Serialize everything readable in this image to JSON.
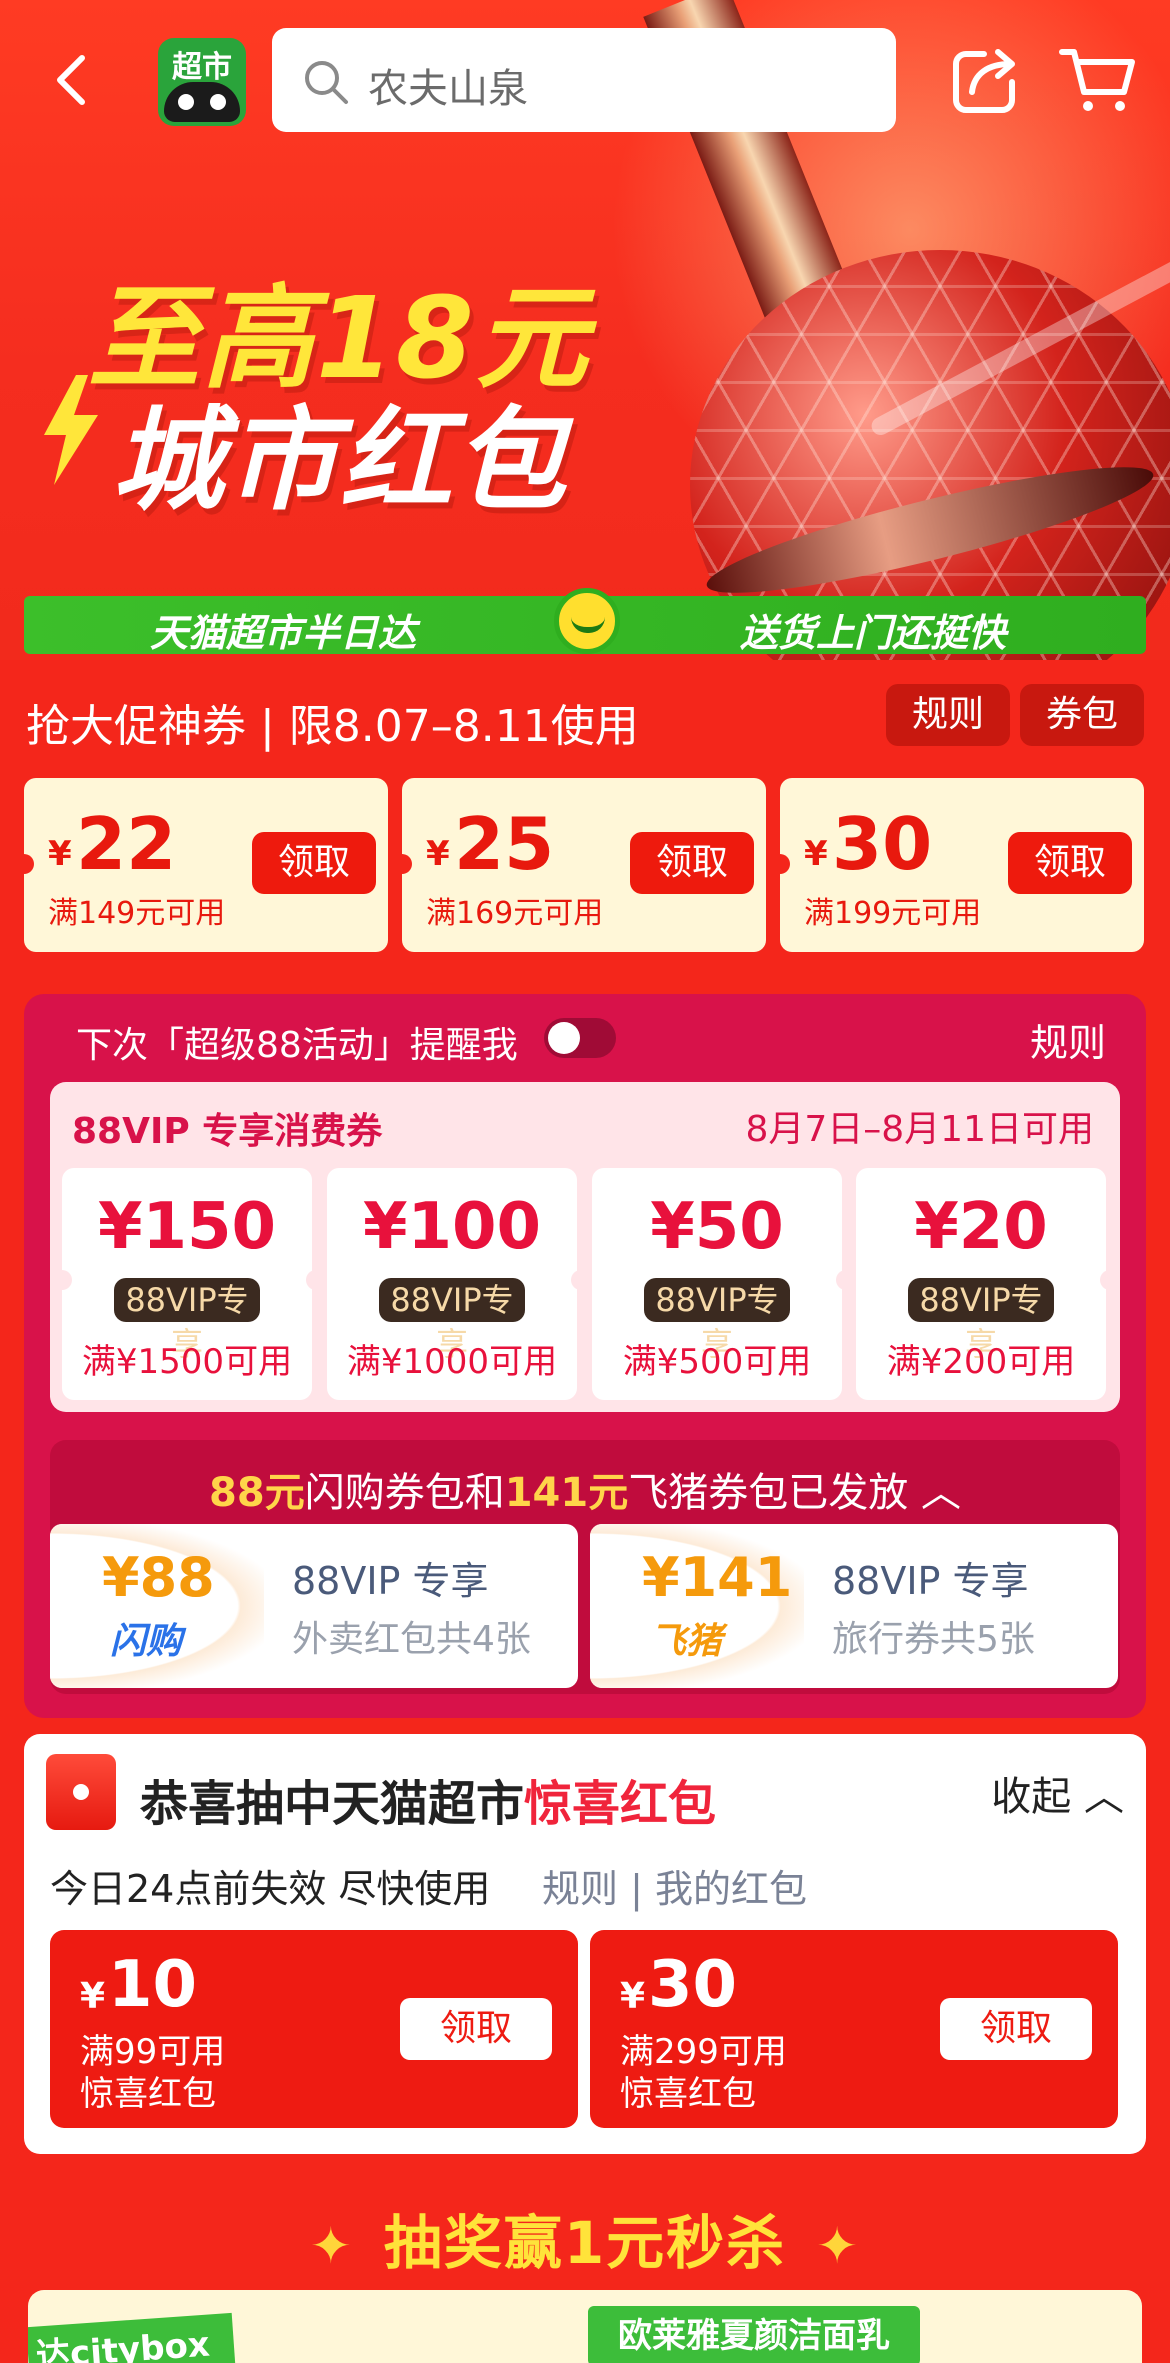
{
  "header": {
    "search_placeholder": "农夫山泉",
    "logo_text": "超市",
    "icons": [
      "back-icon",
      "search-icon",
      "share-icon",
      "cart-icon"
    ]
  },
  "hero": {
    "line1": "至高18元",
    "line2": "城市红包"
  },
  "green_banner": {
    "left": "天猫超市半日达",
    "right": "送货上门还挺快"
  },
  "promo": {
    "title": "抢大促神券 | 限8.07–8.11使用",
    "rules_label": "规则",
    "wallet_label": "券包",
    "coupons": [
      {
        "yen": "¥",
        "amount": "22",
        "condition": "满149元可用",
        "claim": "领取"
      },
      {
        "yen": "¥",
        "amount": "25",
        "condition": "满169元可用",
        "claim": "领取"
      },
      {
        "yen": "¥",
        "amount": "30",
        "condition": "满199元可用",
        "claim": "领取"
      }
    ]
  },
  "vip": {
    "remind_text": "下次「超级88活动」提醒我",
    "remind_enabled": false,
    "rules_label": "规则",
    "card_title": "88VIP 专享消费券",
    "card_date": "8月7日–8月11日可用",
    "coupons": [
      {
        "amount": "¥150",
        "badge": "88VIP专享",
        "condition": "满¥1500可用"
      },
      {
        "amount": "¥100",
        "badge": "88VIP专享",
        "condition": "满¥1000可用"
      },
      {
        "amount": "¥50",
        "badge": "88VIP专享",
        "condition": "满¥500可用"
      },
      {
        "amount": "¥20",
        "badge": "88VIP专享",
        "condition": "满¥200可用"
      }
    ],
    "packs_title_hl1": "88元",
    "packs_title_mid": "闪购券包和",
    "packs_title_hl2": "141元",
    "packs_title_end": "飞猪券包已发放",
    "packs": [
      {
        "amount": "¥88",
        "brand": "闪购",
        "title": "88VIP 专享",
        "desc": "外卖红包共4张"
      },
      {
        "amount": "¥141",
        "brand": "飞猪",
        "title": "88VIP 专享",
        "desc": "旅行券共5张"
      }
    ]
  },
  "surprise": {
    "title_prefix": "恭喜抽中天猫超市",
    "title_highlight": "惊喜红包",
    "collapse_label": "收起",
    "expire_text": "今日24点前失效 尽快使用",
    "links_text": "规则 | 我的红包",
    "packets": [
      {
        "yen": "¥",
        "amount": "10",
        "condition": "满99可用",
        "name": "惊喜红包",
        "claim": "领取"
      },
      {
        "yen": "¥",
        "amount": "30",
        "condition": "满299可用",
        "name": "惊喜红包",
        "claim": "领取"
      }
    ]
  },
  "lottery": {
    "title": "抽奖赢1元秒杀",
    "tag_left": "达citybox",
    "tag_right": "欧莱雅夏颜洁面乳"
  },
  "colors": {
    "brand_red": "#f4261b",
    "vip_pink": "#d8124a",
    "green": "#2fae1f",
    "gold": "#ffe33a"
  }
}
